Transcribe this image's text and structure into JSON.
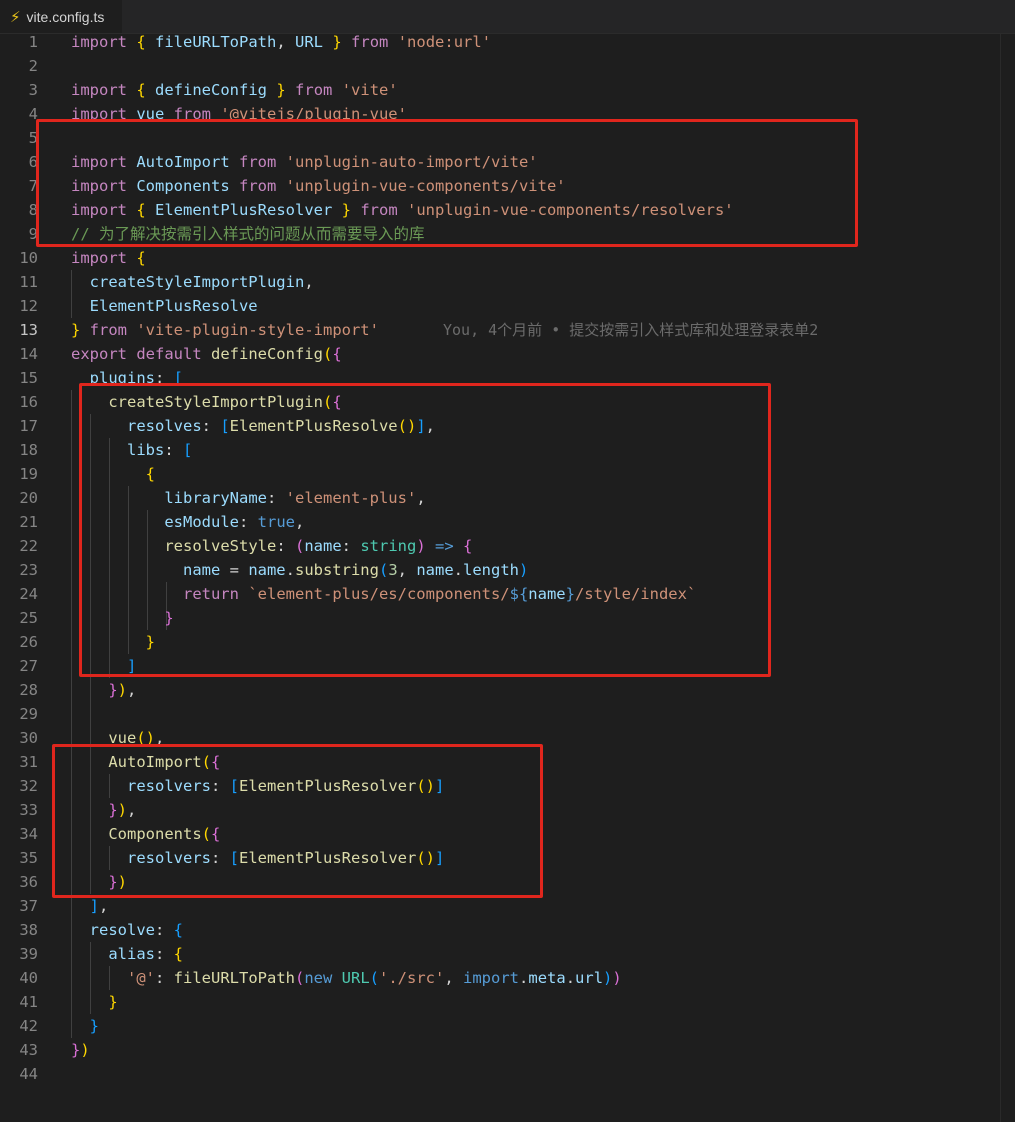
{
  "tab": {
    "icon": "lightning-icon",
    "title": "vite.config.ts"
  },
  "blame": "You, 4个月前 • 提交按需引入样式库和处理登录表单2",
  "highlight_color": "#e0261d",
  "lines": [
    {
      "n": "1",
      "tokens": [
        [
          "k",
          "import"
        ],
        [
          "p",
          " "
        ],
        [
          "b1",
          "{"
        ],
        [
          "v",
          " fileURLToPath"
        ],
        [
          "p",
          ", "
        ],
        [
          "v",
          "URL"
        ],
        [
          "p",
          " "
        ],
        [
          "b1",
          "}"
        ],
        [
          "k",
          " from"
        ],
        [
          "s",
          " 'node:url'"
        ]
      ]
    },
    {
      "n": "2",
      "tokens": []
    },
    {
      "n": "3",
      "tokens": [
        [
          "k",
          "import"
        ],
        [
          "p",
          " "
        ],
        [
          "b1",
          "{"
        ],
        [
          "v",
          " defineConfig"
        ],
        [
          "p",
          " "
        ],
        [
          "b1",
          "}"
        ],
        [
          "k",
          " from"
        ],
        [
          "s",
          " 'vite'"
        ]
      ]
    },
    {
      "n": "4",
      "tokens": [
        [
          "k",
          "import"
        ],
        [
          "v",
          " vue"
        ],
        [
          "k",
          " from"
        ],
        [
          "s",
          " '@vitejs/plugin-vue'"
        ]
      ]
    },
    {
      "n": "5",
      "tokens": []
    },
    {
      "n": "6",
      "tokens": [
        [
          "k",
          "import"
        ],
        [
          "v",
          " AutoImport"
        ],
        [
          "k",
          " from"
        ],
        [
          "s",
          " 'unplugin-auto-import/vite'"
        ]
      ]
    },
    {
      "n": "7",
      "tokens": [
        [
          "k",
          "import"
        ],
        [
          "v",
          " Components"
        ],
        [
          "k",
          " from"
        ],
        [
          "s",
          " 'unplugin-vue-components/vite'"
        ]
      ]
    },
    {
      "n": "8",
      "tokens": [
        [
          "k",
          "import"
        ],
        [
          "p",
          " "
        ],
        [
          "b1",
          "{"
        ],
        [
          "v",
          " ElementPlusResolver"
        ],
        [
          "p",
          " "
        ],
        [
          "b1",
          "}"
        ],
        [
          "k",
          " from"
        ],
        [
          "s",
          " 'unplugin-vue-components/resolvers'"
        ]
      ]
    },
    {
      "n": "9",
      "tokens": [
        [
          "c",
          "// 为了解决按需引入样式的问题从而需要导入的库"
        ]
      ]
    },
    {
      "n": "10",
      "tokens": [
        [
          "k",
          "import"
        ],
        [
          "p",
          " "
        ],
        [
          "b1",
          "{"
        ]
      ]
    },
    {
      "n": "11",
      "tokens": [
        [
          "p",
          "  "
        ],
        [
          "v",
          "createStyleImportPlugin"
        ],
        [
          "p",
          ","
        ]
      ]
    },
    {
      "n": "12",
      "tokens": [
        [
          "p",
          "  "
        ],
        [
          "v",
          "ElementPlusResolve"
        ]
      ]
    },
    {
      "n": "13",
      "tokens": [
        [
          "b1",
          "}"
        ],
        [
          "k",
          " from"
        ],
        [
          "s",
          " 'vite-plugin-style-import'"
        ]
      ],
      "blame": true,
      "active": true
    },
    {
      "n": "14",
      "tokens": [
        [
          "k",
          "export"
        ],
        [
          "k",
          " default"
        ],
        [
          "f",
          " defineConfig"
        ],
        [
          "b1",
          "("
        ],
        [
          "b2",
          "{"
        ]
      ]
    },
    {
      "n": "15",
      "tokens": [
        [
          "p",
          "  "
        ],
        [
          "v",
          "plugins"
        ],
        [
          "p",
          ": "
        ],
        [
          "b3",
          "["
        ]
      ]
    },
    {
      "n": "16",
      "tokens": [
        [
          "p",
          "    "
        ],
        [
          "f",
          "createStyleImportPlugin"
        ],
        [
          "b1",
          "("
        ],
        [
          "b2",
          "{"
        ]
      ]
    },
    {
      "n": "17",
      "tokens": [
        [
          "p",
          "      "
        ],
        [
          "v",
          "resolves"
        ],
        [
          "p",
          ": "
        ],
        [
          "b3",
          "["
        ],
        [
          "f",
          "ElementPlusResolve"
        ],
        [
          "b1",
          "()"
        ],
        [
          "b3",
          "]"
        ],
        [
          "p",
          ","
        ]
      ]
    },
    {
      "n": "18",
      "tokens": [
        [
          "p",
          "      "
        ],
        [
          "v",
          "libs"
        ],
        [
          "p",
          ": "
        ],
        [
          "b3",
          "["
        ]
      ]
    },
    {
      "n": "19",
      "tokens": [
        [
          "p",
          "        "
        ],
        [
          "b1",
          "{"
        ]
      ]
    },
    {
      "n": "20",
      "tokens": [
        [
          "p",
          "          "
        ],
        [
          "v",
          "libraryName"
        ],
        [
          "p",
          ": "
        ],
        [
          "s",
          "'element-plus'"
        ],
        [
          "p",
          ","
        ]
      ]
    },
    {
      "n": "21",
      "tokens": [
        [
          "p",
          "          "
        ],
        [
          "v",
          "esModule"
        ],
        [
          "p",
          ": "
        ],
        [
          "kb",
          "true"
        ],
        [
          "p",
          ","
        ]
      ]
    },
    {
      "n": "22",
      "tokens": [
        [
          "p",
          "          "
        ],
        [
          "f",
          "resolveStyle"
        ],
        [
          "p",
          ": "
        ],
        [
          "b2",
          "("
        ],
        [
          "v",
          "name"
        ],
        [
          "p",
          ": "
        ],
        [
          "t",
          "string"
        ],
        [
          "b2",
          ")"
        ],
        [
          "kb",
          " =>"
        ],
        [
          "p",
          " "
        ],
        [
          "b2",
          "{"
        ]
      ]
    },
    {
      "n": "23",
      "tokens": [
        [
          "p",
          "            "
        ],
        [
          "v",
          "name"
        ],
        [
          "p",
          " = "
        ],
        [
          "v",
          "name"
        ],
        [
          "p",
          "."
        ],
        [
          "f",
          "substring"
        ],
        [
          "b3",
          "("
        ],
        [
          "n",
          "3"
        ],
        [
          "p",
          ", "
        ],
        [
          "v",
          "name"
        ],
        [
          "p",
          "."
        ],
        [
          "v",
          "length"
        ],
        [
          "b3",
          ")"
        ]
      ]
    },
    {
      "n": "24",
      "tokens": [
        [
          "p",
          "            "
        ],
        [
          "k",
          "return"
        ],
        [
          "p",
          " "
        ],
        [
          "s",
          "`element-plus/es/components/"
        ],
        [
          "kb",
          "${"
        ],
        [
          "v",
          "name"
        ],
        [
          "kb",
          "}"
        ],
        [
          "s",
          "/style/index`"
        ]
      ]
    },
    {
      "n": "25",
      "tokens": [
        [
          "p",
          "          "
        ],
        [
          "b2",
          "}"
        ]
      ]
    },
    {
      "n": "26",
      "tokens": [
        [
          "p",
          "        "
        ],
        [
          "b1",
          "}"
        ]
      ]
    },
    {
      "n": "27",
      "tokens": [
        [
          "p",
          "      "
        ],
        [
          "b3",
          "]"
        ]
      ]
    },
    {
      "n": "28",
      "tokens": [
        [
          "p",
          "    "
        ],
        [
          "b2",
          "}"
        ],
        [
          "b1",
          ")"
        ],
        [
          "p",
          ","
        ]
      ]
    },
    {
      "n": "29",
      "tokens": []
    },
    {
      "n": "30",
      "tokens": [
        [
          "p",
          "    "
        ],
        [
          "f",
          "vue"
        ],
        [
          "b1",
          "()"
        ],
        [
          "p",
          ","
        ]
      ]
    },
    {
      "n": "31",
      "tokens": [
        [
          "p",
          "    "
        ],
        [
          "f",
          "AutoImport"
        ],
        [
          "b1",
          "("
        ],
        [
          "b2",
          "{"
        ]
      ]
    },
    {
      "n": "32",
      "tokens": [
        [
          "p",
          "      "
        ],
        [
          "v",
          "resolvers"
        ],
        [
          "p",
          ": "
        ],
        [
          "b3",
          "["
        ],
        [
          "f",
          "ElementPlusResolver"
        ],
        [
          "b1",
          "()"
        ],
        [
          "b3",
          "]"
        ]
      ]
    },
    {
      "n": "33",
      "tokens": [
        [
          "p",
          "    "
        ],
        [
          "b2",
          "}"
        ],
        [
          "b1",
          ")"
        ],
        [
          "p",
          ","
        ]
      ]
    },
    {
      "n": "34",
      "tokens": [
        [
          "p",
          "    "
        ],
        [
          "f",
          "Components"
        ],
        [
          "b1",
          "("
        ],
        [
          "b2",
          "{"
        ]
      ]
    },
    {
      "n": "35",
      "tokens": [
        [
          "p",
          "      "
        ],
        [
          "v",
          "resolvers"
        ],
        [
          "p",
          ": "
        ],
        [
          "b3",
          "["
        ],
        [
          "f",
          "ElementPlusResolver"
        ],
        [
          "b1",
          "()"
        ],
        [
          "b3",
          "]"
        ]
      ]
    },
    {
      "n": "36",
      "tokens": [
        [
          "p",
          "    "
        ],
        [
          "b2",
          "}"
        ],
        [
          "b1",
          ")"
        ]
      ]
    },
    {
      "n": "37",
      "tokens": [
        [
          "p",
          "  "
        ],
        [
          "b3",
          "]"
        ],
        [
          "p",
          ","
        ]
      ]
    },
    {
      "n": "38",
      "tokens": [
        [
          "p",
          "  "
        ],
        [
          "v",
          "resolve"
        ],
        [
          "p",
          ": "
        ],
        [
          "b3",
          "{"
        ]
      ]
    },
    {
      "n": "39",
      "tokens": [
        [
          "p",
          "    "
        ],
        [
          "v",
          "alias"
        ],
        [
          "p",
          ": "
        ],
        [
          "b1",
          "{"
        ]
      ]
    },
    {
      "n": "40",
      "tokens": [
        [
          "p",
          "      "
        ],
        [
          "s",
          "'@'"
        ],
        [
          "p",
          ": "
        ],
        [
          "f",
          "fileURLToPath"
        ],
        [
          "b2",
          "("
        ],
        [
          "kb",
          "new"
        ],
        [
          "t",
          " URL"
        ],
        [
          "b3",
          "("
        ],
        [
          "s",
          "'./src'"
        ],
        [
          "p",
          ", "
        ],
        [
          "kb",
          "import"
        ],
        [
          "p",
          "."
        ],
        [
          "v",
          "meta"
        ],
        [
          "p",
          "."
        ],
        [
          "v",
          "url"
        ],
        [
          "b3",
          ")"
        ],
        [
          "b2",
          ")"
        ]
      ]
    },
    {
      "n": "41",
      "tokens": [
        [
          "p",
          "    "
        ],
        [
          "b1",
          "}"
        ]
      ]
    },
    {
      "n": "42",
      "tokens": [
        [
          "p",
          "  "
        ],
        [
          "b3",
          "}"
        ]
      ]
    },
    {
      "n": "43",
      "tokens": [
        [
          "b2",
          "}"
        ],
        [
          "b1",
          ")"
        ]
      ]
    },
    {
      "n": "44",
      "tokens": []
    }
  ]
}
